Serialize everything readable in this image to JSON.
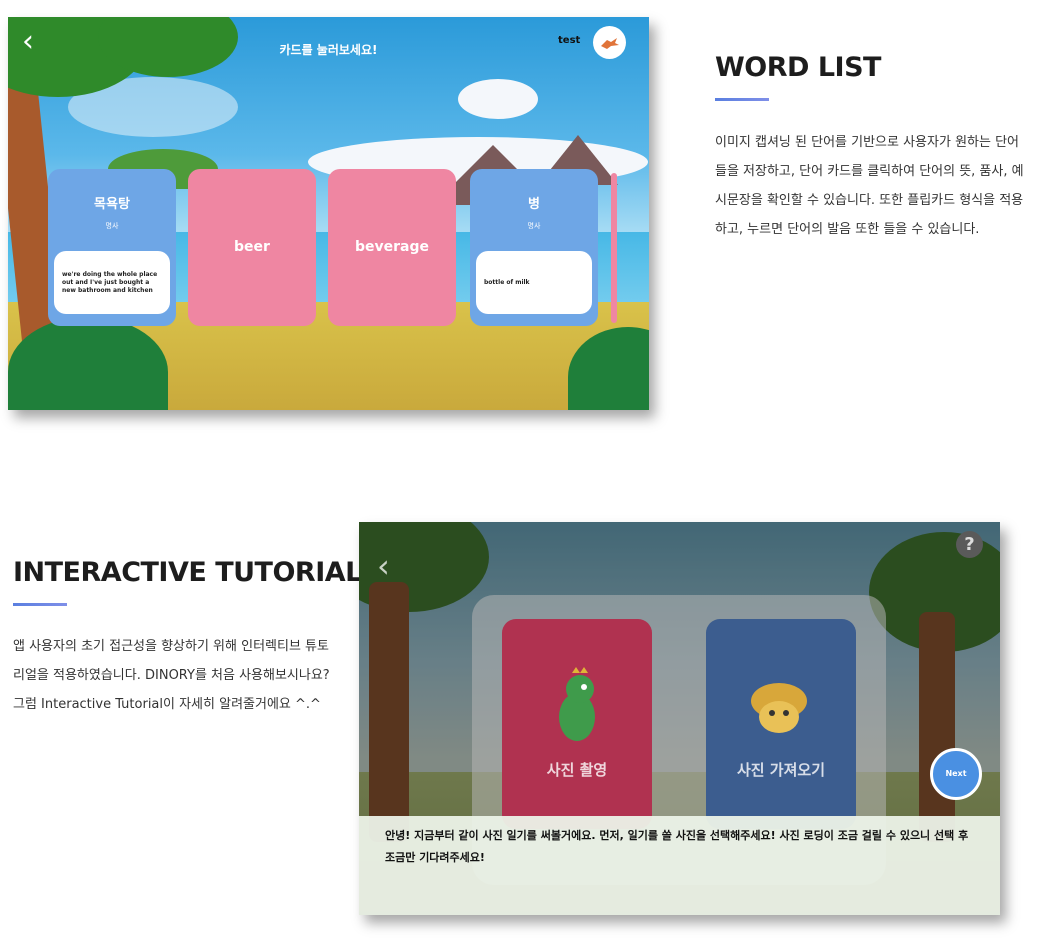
{
  "word_list_screen": {
    "back_glyph": "‹",
    "title": "카드를 눌러보세요!",
    "user_name": "test",
    "cards": [
      {
        "style": "blue",
        "word": "목욕탕",
        "pos": "명사",
        "example": "we're doing the whole place out and I've just bought a new bathroom and kitchen"
      },
      {
        "style": "pink",
        "word": "beer"
      },
      {
        "style": "pink",
        "word": "beverage"
      },
      {
        "style": "blue",
        "word": "병",
        "pos": "명사",
        "example": "bottle of milk"
      }
    ]
  },
  "word_list_section": {
    "heading": "WORD LIST",
    "description": "이미지 캡셔닝 된 단어를 기반으로 사용자가 원하는 단어들을 저장하고, 단어 카드를 클릭하여 단어의 뜻, 품사, 예시문장을 확인할 수 있습니다. 또한 플립카드 형식을 적용하고, 누르면 단어의 발음 또한 들을 수 있습니다."
  },
  "tutorial_section": {
    "heading": "INTERACTIVE TUTORIAL",
    "description": "앱 사용자의 초기 접근성을 향상하기 위해 인터렉티브 튜토리얼을 적용하였습니다. DINORY를 처음 사용해보시나요? 그럼 Interactive Tutorial이 자세히 알려줄거에요 ^.^"
  },
  "tutorial_screen": {
    "back_glyph": "‹",
    "help_glyph": "?",
    "take_photo_label": "사진 촬영",
    "load_photo_label": "사진 가져오기",
    "next_label": "Next",
    "tooltip": "안녕! 지금부터 같이 사진 일기를 써볼거에요. 먼저, 일기를 쓸 사진을 선택해주세요! 사진 로딩이 조금 걸릴 수 있으니 선택 후 조금만 기다려주세요!"
  },
  "colors": {
    "accent_underline": "#5a7fe0",
    "card_blue": "#6ea6e6",
    "card_pink": "#ef86a2",
    "next_button": "#4a90e2"
  }
}
